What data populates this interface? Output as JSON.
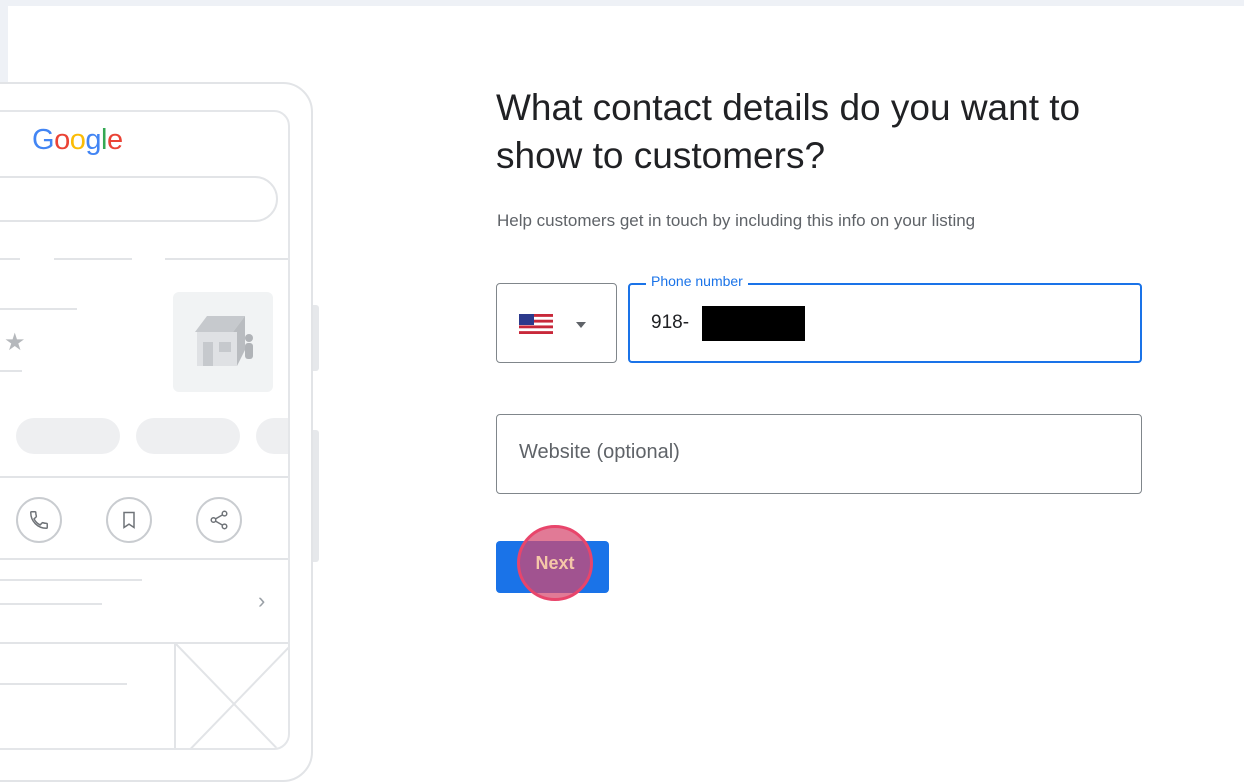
{
  "preview": {
    "logo": [
      "G",
      "o",
      "o",
      "g",
      "l",
      "e"
    ],
    "logo_colors": [
      "#4285F4",
      "#EA4335",
      "#FBBC05",
      "#4285F4",
      "#34A853",
      "#EA4335"
    ],
    "rating_star": "★",
    "chevron": "›"
  },
  "form": {
    "title": "What contact details do you want to show to customers?",
    "subtitle": "Help customers get in touch by including this info on your listing",
    "country_icon": "us-flag-icon",
    "phone_label": "Phone number",
    "phone_value": "918-",
    "website_placeholder": "Website (optional)",
    "next_label": "Next"
  },
  "colors": {
    "accent": "#1a73e8",
    "click_highlight": "#e8456b"
  }
}
